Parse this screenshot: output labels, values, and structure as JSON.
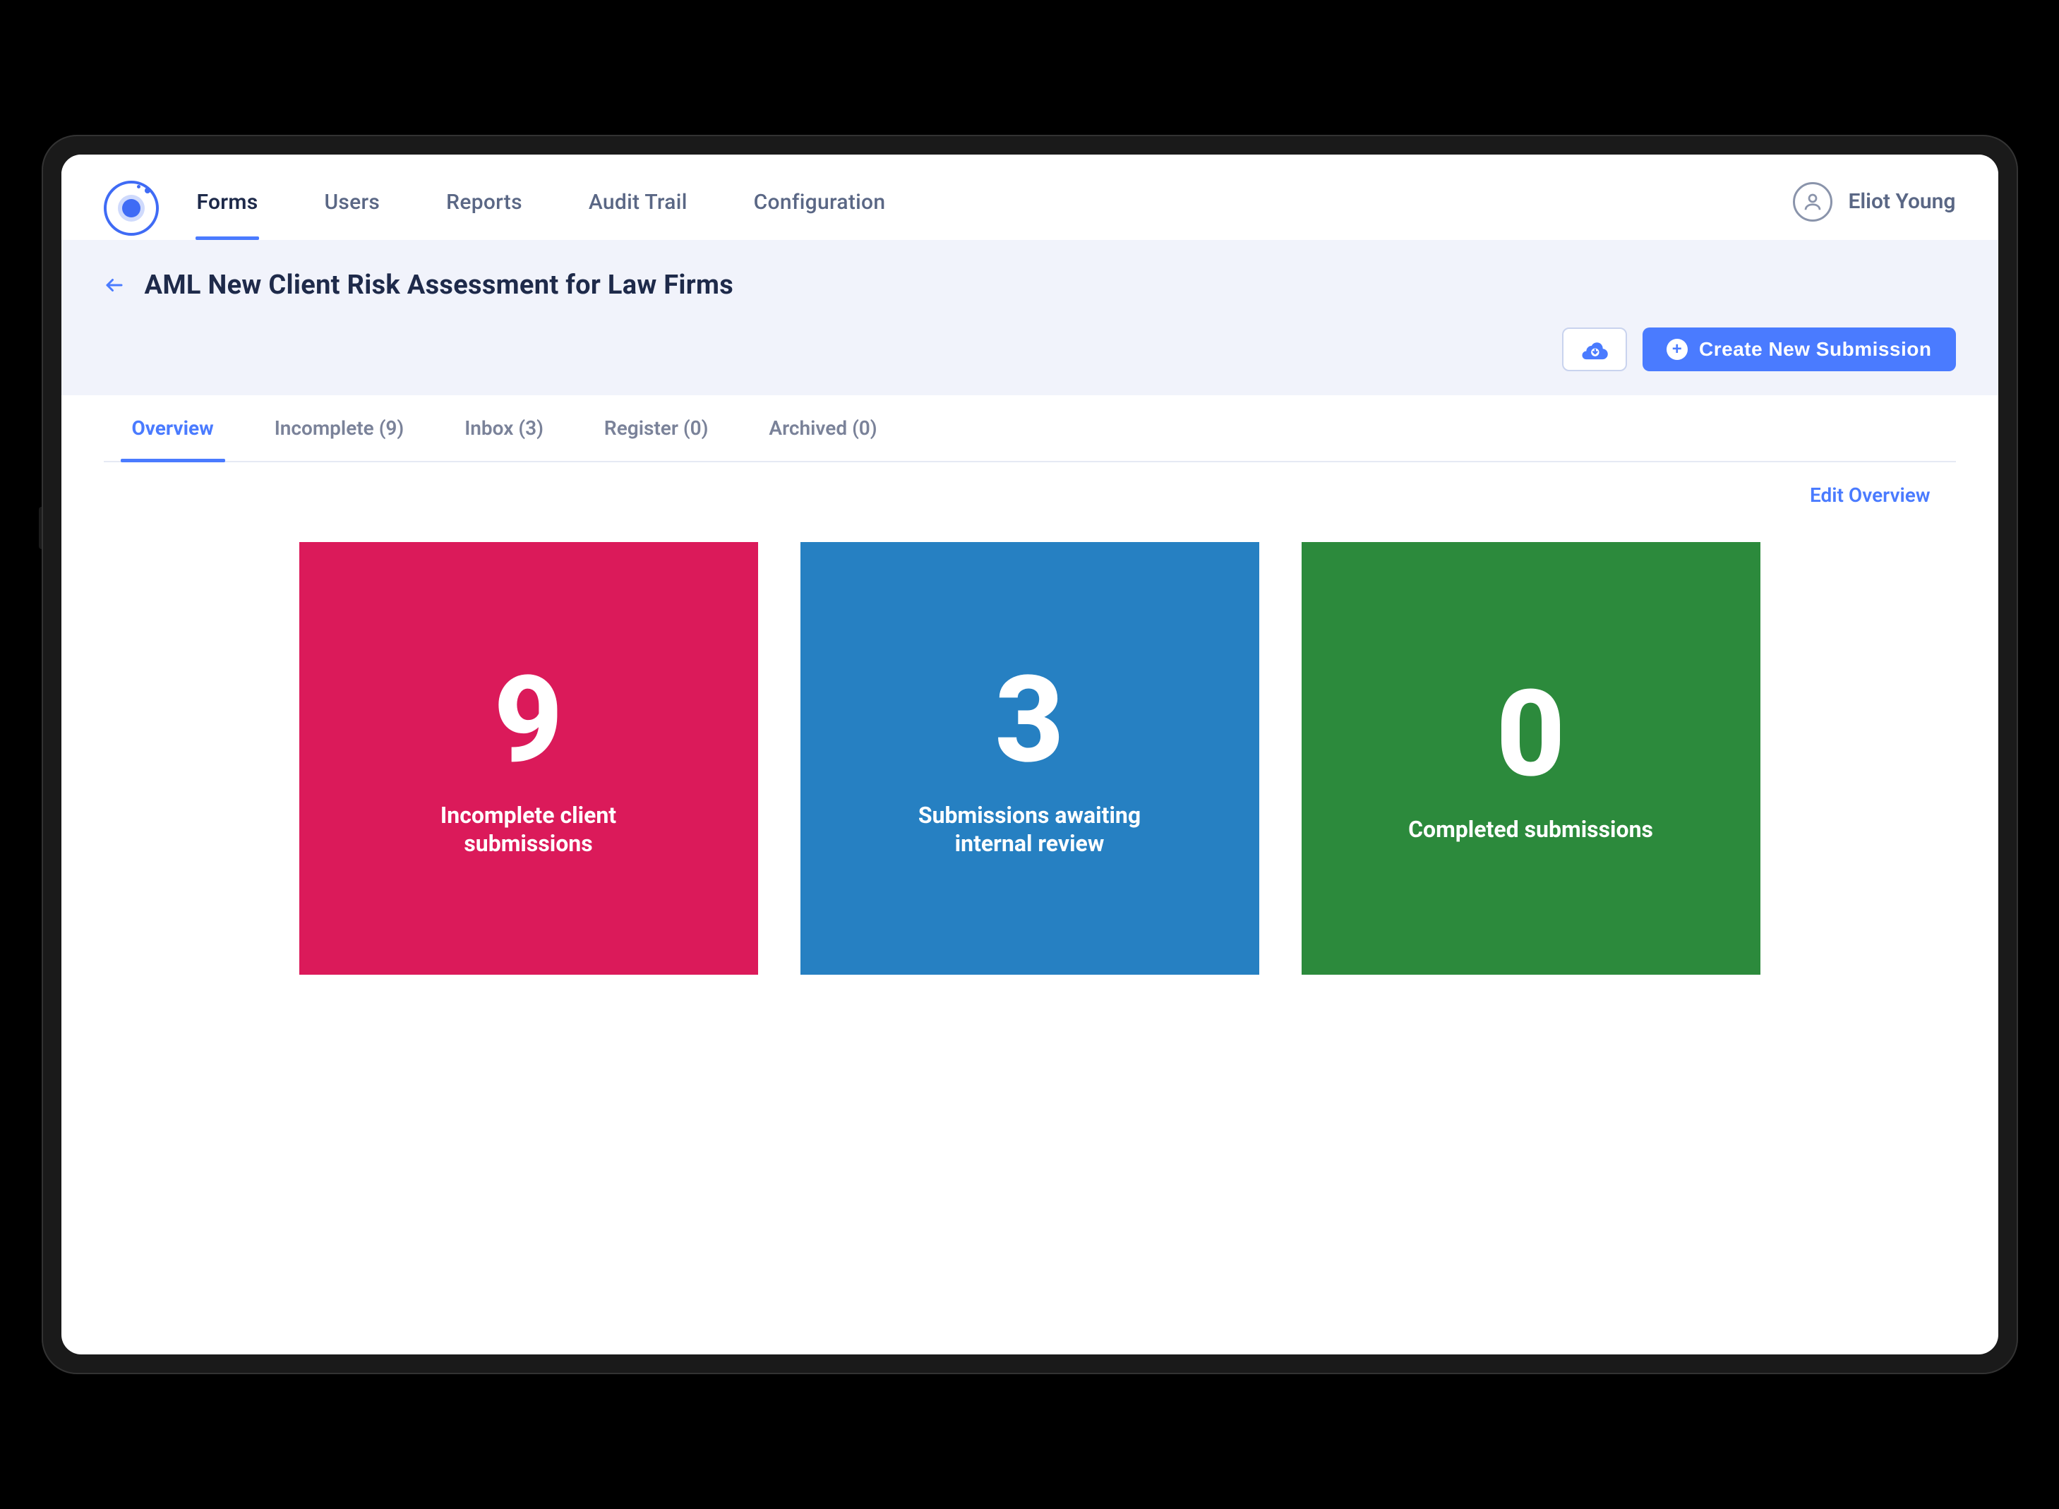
{
  "nav": {
    "items": [
      {
        "label": "Forms",
        "active": true
      },
      {
        "label": "Users",
        "active": false
      },
      {
        "label": "Reports",
        "active": false
      },
      {
        "label": "Audit Trail",
        "active": false
      },
      {
        "label": "Configuration",
        "active": false
      }
    ],
    "user_name": "Eliot Young"
  },
  "page": {
    "title": "AML New Client Risk Assessment for Law Firms",
    "create_button_label": "Create New Submission"
  },
  "tabs": [
    {
      "label": "Overview",
      "active": true
    },
    {
      "label": "Incomplete (9)",
      "active": false
    },
    {
      "label": "Inbox (3)",
      "active": false
    },
    {
      "label": "Register (0)",
      "active": false
    },
    {
      "label": "Archived (0)",
      "active": false
    }
  ],
  "overview": {
    "edit_link_label": "Edit Overview",
    "cards": [
      {
        "value": "9",
        "label": "Incomplete client submissions",
        "color": "pink"
      },
      {
        "value": "3",
        "label": "Submissions awaiting internal review",
        "color": "blue"
      },
      {
        "value": "0",
        "label": "Completed submissions",
        "color": "green"
      }
    ]
  }
}
